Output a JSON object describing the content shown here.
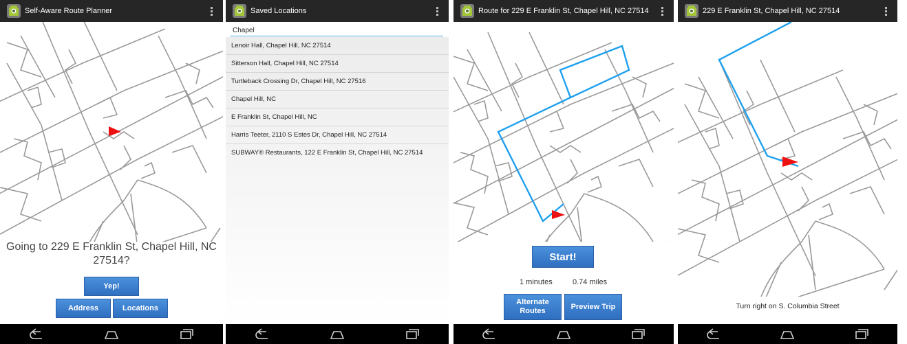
{
  "screens": [
    {
      "title": "Self-Aware Route Planner",
      "prompt": "Going to 229 E Franklin St, Chapel Hill, NC 27514?",
      "yep_label": "Yep!",
      "address_label": "Address",
      "locations_label": "Locations"
    },
    {
      "title": "Saved Locations",
      "search_value": "Chapel",
      "items": [
        "Lenoir Hall, Chapel Hill, NC 27514",
        "Sitterson Hall, Chapel Hill, NC 27514",
        "Turtleback Crossing Dr, Chapel Hill, NC 27516",
        "Chapel Hill, NC",
        "E Franklin St, Chapel Hill, NC",
        "Harris Teeter, 2110 S Estes Dr, Chapel Hill, NC 27514",
        "SUBWAY® Restaurants, 122 E Franklin St, Chapel Hill, NC 27514"
      ]
    },
    {
      "title": "Route for 229 E Franklin St, Chapel Hill, NC 27514",
      "start_label": "Start!",
      "duration": "1 minutes",
      "distance": "0.74 miles",
      "alternate_label": "Alternate Routes",
      "preview_label": "Preview Trip"
    },
    {
      "title": "229 E Franklin St, Chapel Hill, NC 27514",
      "instruction": "Turn right on S. Columbia Street"
    }
  ],
  "icons": {
    "app": "android-app-icon",
    "overflow": "overflow-menu-icon",
    "back": "back-icon",
    "home": "home-icon",
    "recents": "recents-icon"
  },
  "colors": {
    "actionbar": "#262626",
    "button": "#3a7fcf",
    "route": "#1ea0ef",
    "marker": "#ee1111",
    "road": "#9a9a9a"
  }
}
